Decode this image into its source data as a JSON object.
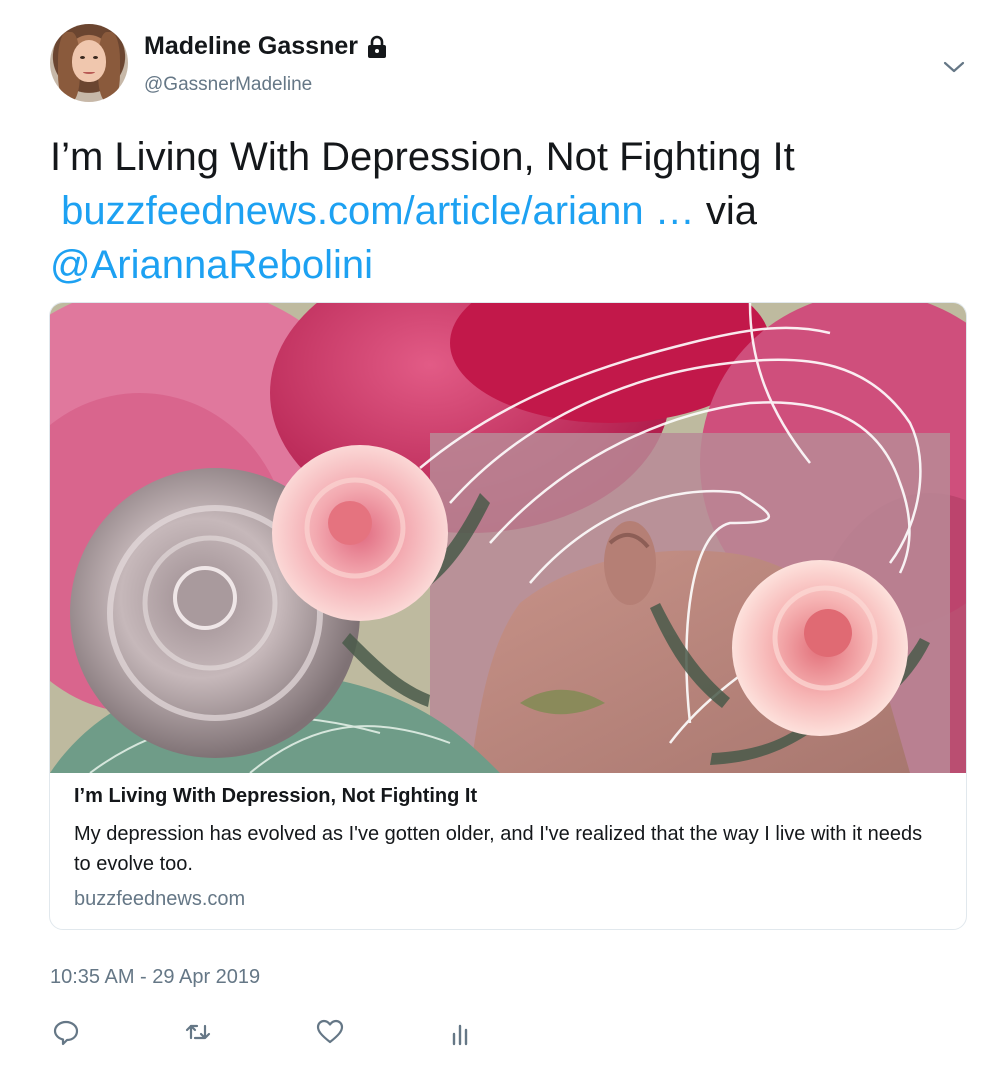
{
  "author": {
    "name": "Madeline Gassner",
    "handle": "@GassnerMadeline",
    "protected_icon": "lock-icon",
    "avatar_icon": "user-avatar-photo"
  },
  "menu_icon": "chevron-down-icon",
  "tweet": {
    "text_main": "I’m Living With Depression, Not Fighting It",
    "link_text": "buzzfeednews.com/article/ariann",
    "ellipsis": " …",
    "via_text": " via",
    "mention": "@AriannaRebolini"
  },
  "card": {
    "title": "I’m Living With Depression, Not Fighting It",
    "description": "My depression has evolved as I've gotten older, and I've realized that the way I live with it needs to evolve too.",
    "domain": "buzzfeednews.com",
    "image_icon": "article-collage-image"
  },
  "timestamp": "10:35 AM - 29 Apr 2019",
  "actions": [
    {
      "name": "reply",
      "icon": "reply-icon"
    },
    {
      "name": "retweet",
      "icon": "retweet-icon"
    },
    {
      "name": "like",
      "icon": "heart-icon"
    },
    {
      "name": "analytics",
      "icon": "analytics-icon"
    }
  ],
  "colors": {
    "link": "#1da1f2",
    "text": "#14171a",
    "secondary": "#657786",
    "border": "#e1e8ed"
  }
}
